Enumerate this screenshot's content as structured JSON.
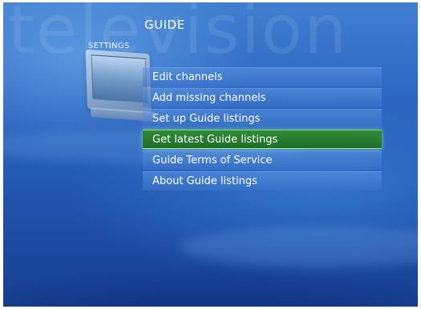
{
  "screen": {
    "watermark": "television",
    "title": "GUIDE",
    "section": "SETTINGS"
  },
  "menu": {
    "items": [
      {
        "label": "Edit channels",
        "selected": false
      },
      {
        "label": "Add missing channels",
        "selected": false
      },
      {
        "label": "Set up Guide listings",
        "selected": false
      },
      {
        "label": "Get latest Guide listings",
        "selected": true
      },
      {
        "label": "Guide Terms of Service",
        "selected": false
      },
      {
        "label": "About Guide listings",
        "selected": false
      }
    ]
  },
  "colors": {
    "background": "#2d68c2",
    "item": "#4c86d2",
    "selected": "#2f8b36"
  },
  "icons": {
    "section_image": "tv-icon"
  }
}
